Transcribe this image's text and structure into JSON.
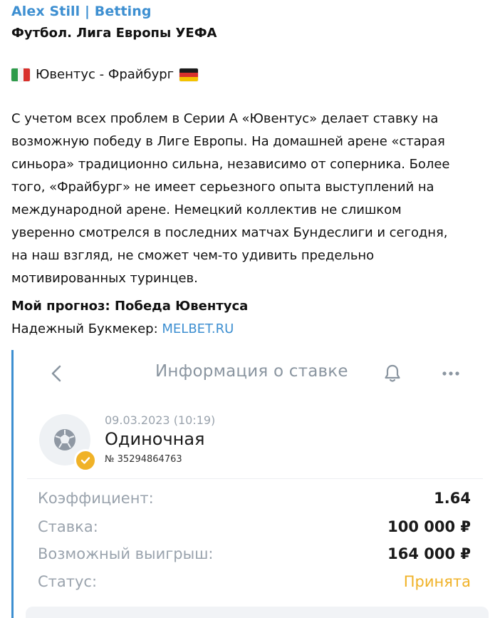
{
  "message": {
    "channel_name": "Alex Still | Betting",
    "league": "Футбол. Лига Европы УЕФА",
    "match": "Ювентус - Фрайбург",
    "flags": {
      "home": "italy-flag",
      "away": "germany-flag"
    },
    "body_lines": [
      "С учетом всех проблем в Серии А «Ювентус» делает ставку на",
      "возможную победу в Лиге Европы. На домашней арене «старая",
      "синьора» традиционно сильна, независимо от соперника. Более",
      "того, «Фрайбург» не имеет серьезного опыта выступлений на",
      "международной арене. Немецкий коллектив не слишком",
      "уверенно смотрелся в последних матчах Бундеслиги и сегодня,",
      "на наш взгляд, не сможет чем-то удивить предельно",
      "мотивированных туринцев."
    ],
    "forecast": "Мой прогноз: Победа Ювентуса",
    "bookie_label": "Надежный Букмекер: ",
    "bookie_link": "MELBET.RU"
  },
  "bet_card": {
    "header_title": "Информация о ставке",
    "icons": {
      "back": "chevron-left-icon",
      "bell": "bell-icon",
      "more": "more-dots-icon",
      "avatar": "soccer-ball-icon",
      "badge": "check-icon"
    },
    "date": "09.03.2023 (10:19)",
    "type": "Одиночная",
    "number": "№ 35294864763",
    "rows": [
      {
        "label": "Коэффициент:",
        "value": "1.64"
      },
      {
        "label": "Ставка:",
        "value": "100 000 ₽"
      },
      {
        "label": "Возможный выигрыш:",
        "value": "164 000 ₽"
      },
      {
        "label": "Статус:",
        "value": "Принята"
      }
    ],
    "colors": {
      "accent": "#3d8fd1",
      "status": "#f0b227",
      "muted": "#9aa3ad"
    }
  }
}
